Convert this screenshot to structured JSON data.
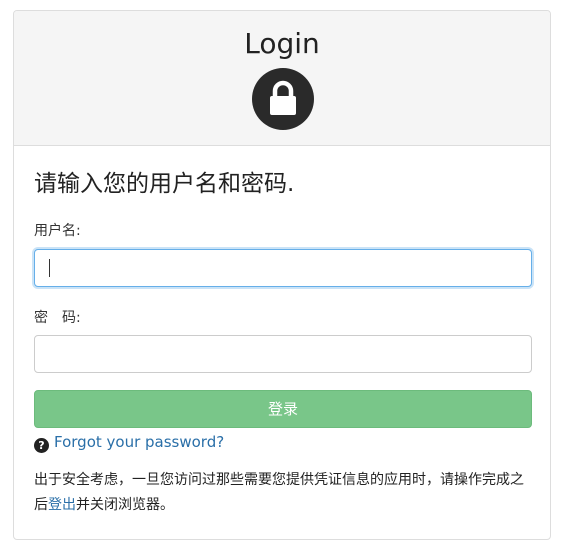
{
  "header": {
    "title": "Login",
    "lock_icon": "lock-icon"
  },
  "form": {
    "prompt": "请输入您的用户名和密码.",
    "username_label": "用户名:",
    "username_value": "",
    "password_label": "密　码:",
    "password_value": "",
    "submit_label": "登录",
    "submit_color": "#79c689"
  },
  "forgot": {
    "icon": "question-circle-icon",
    "link_text": "Forgot your password?"
  },
  "notice": {
    "text_before": "出于安全考虑，一旦您访问过那些需要您提供凭证信息的应用时，请操作完成之后",
    "logout_link": "登出",
    "text_after": "并关闭浏览器。"
  }
}
